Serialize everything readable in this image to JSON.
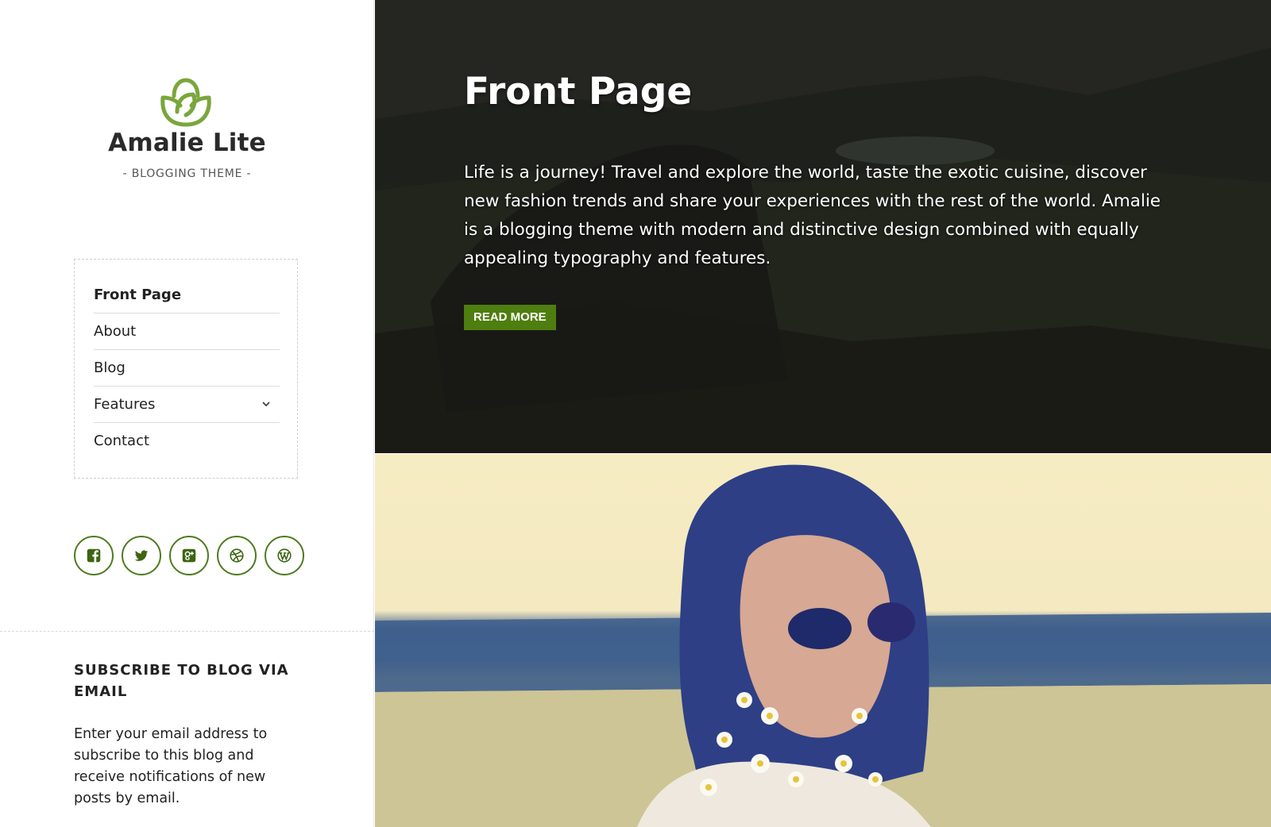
{
  "site": {
    "title": "Amalie Lite",
    "tagline": "- BLOGGING THEME -",
    "logo_icon": "rose-logo-icon",
    "accent_color": "#4e7e0f"
  },
  "nav": {
    "items": [
      {
        "label": "Front Page",
        "current": true
      },
      {
        "label": "About"
      },
      {
        "label": "Blog"
      },
      {
        "label": "Features",
        "has_submenu": true
      },
      {
        "label": "Contact"
      }
    ]
  },
  "social": [
    "facebook-icon",
    "twitter-icon",
    "google-plus-icon",
    "dribbble-icon",
    "wordpress-icon"
  ],
  "widget": {
    "title": "SUBSCRIBE TO BLOG VIA EMAIL",
    "text": "Enter your email address to subscribe to this blog and receive notifications of new posts by email."
  },
  "hero": {
    "title": "Front Page",
    "text": "Life is a journey! Travel and explore the world, taste the exotic cuisine, discover new fashion trends and share your experiences with the rest of the world. Amalie is a blogging theme with modern and distinctive design combined with equally appealing typography and features.",
    "button_label": "READ MORE"
  }
}
